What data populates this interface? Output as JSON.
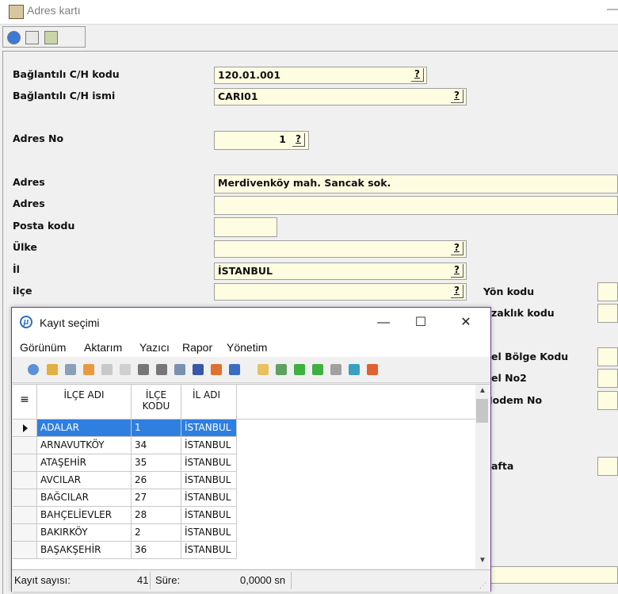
{
  "window": {
    "title": "Adres kartı"
  },
  "form": {
    "labels": {
      "cari_kod": "Bağlantılı C/H kodu",
      "cari_isim": "Bağlantılı C/H ismi",
      "adres_no": "Adres No",
      "adres1": "Adres",
      "adres2": "Adres",
      "posta_kodu": "Posta kodu",
      "ulke": "Ülke",
      "il": "İl",
      "ilce": "ilçe",
      "yon_kodu": "Yön kodu",
      "uzaklik_kodu": "zaklık kodu",
      "ozel_bolge": "el Bölge Kodu",
      "ozel_no2": "el No2",
      "odem_no": "Iodem No",
      "hafta": "afta"
    },
    "values": {
      "cari_kod": "120.01.001",
      "cari_isim": "CARI01",
      "adres_no": "1",
      "adres1": "Merdivenköy mah. Sancak sok.",
      "adres2": "",
      "posta_kodu": "",
      "ulke": "",
      "il": "İSTANBUL",
      "ilce": ""
    },
    "lookup_glyph": "?"
  },
  "dialog": {
    "title": "Kayıt seçimi",
    "icon_letter": "μ",
    "caption_buttons": {
      "minimize": "—",
      "maximize": "☐",
      "close": "✕"
    },
    "menu": [
      "Görünüm",
      "Aktarım",
      "Yazıcı",
      "Rapor",
      "Yönetim"
    ],
    "columns": [
      "İLÇE ADI",
      "İLÇE KODU",
      "İL ADI"
    ],
    "rows": [
      [
        "ADALAR",
        "1",
        "İSTANBUL"
      ],
      [
        "ARNAVUTKÖY",
        "34",
        "İSTANBUL"
      ],
      [
        "ATAŞEHİR",
        "35",
        "İSTANBUL"
      ],
      [
        "AVCILAR",
        "26",
        "İSTANBUL"
      ],
      [
        "BAĞCILAR",
        "27",
        "İSTANBUL"
      ],
      [
        "BAHÇELİEVLER",
        "28",
        "İSTANBUL"
      ],
      [
        "BAKIRKÖY",
        "2",
        "İSTANBUL"
      ],
      [
        "BAŞAKŞEHİR",
        "36",
        "İSTANBUL"
      ]
    ],
    "selected_row": 0,
    "status": {
      "count_label": "Kayıt sayısı:",
      "count_value": "41",
      "time_label": "Süre:",
      "time_value": "0,0000 sn"
    }
  },
  "colors": {
    "field_bg": "#fffde1",
    "selection": "#2e7fe0",
    "dialog_border": "#6b3d88"
  }
}
